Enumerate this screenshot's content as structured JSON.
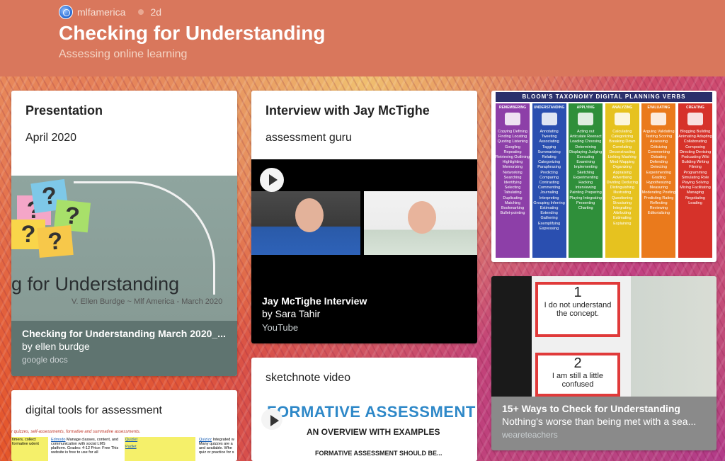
{
  "header": {
    "author": "mlfamerica",
    "age": "2d",
    "title": "Checking for Understanding",
    "subtitle": "Assessing online learning"
  },
  "cards": {
    "presentation": {
      "title": "Presentation",
      "subtitle": "April 2020",
      "slide_text": "g for Understanding",
      "slide_credit": "V. Ellen Burdge ~ Mlf America - March 2020",
      "attachment_title": "Checking for Understanding March 2020_...",
      "attachment_by": "by ellen burdge",
      "attachment_source": "google docs",
      "attachment_bg": "#5f7470"
    },
    "interview": {
      "title": "Interview with Jay McTighe",
      "subtitle": "assessment guru",
      "attachment_title": "Jay McTighe Interview",
      "attachment_by": "by Sara Tahir",
      "attachment_source": "YouTube"
    },
    "bloom": {
      "heading": "BLOOM'S TAXONOMY DIGITAL PLANNING VERBS",
      "columns": [
        {
          "name": "REMEMBERING",
          "color": "#8d3fa8",
          "verbs": "Copying Defining Finding Locating Quoting Listening Googling Repeating Retrieving Outlining Highlighting Memorizing Networking Searching Identifying Selecting Tabulating Duplicating Matching Bookmarking Bullet-pointing"
        },
        {
          "name": "UNDERSTANDING",
          "color": "#2a4fb0",
          "verbs": "Annotating Tweeting Associating Tagging Summarizing Relating Categorizing Paraphrasing Predicting Comparing Contrasting Commenting Journaling Interpreting Grouping Inferring Estimating Extending Gathering Exemplifying Expressing"
        },
        {
          "name": "APPLYING",
          "color": "#2f8f3a",
          "verbs": "Acting out Articulate Reenact Loading Choosing Determining Displaying Judging Executing Examining Implementing Sketching Experimenting Hacking Interviewing Painting Preparing Playing Integrating Presenting Charting"
        },
        {
          "name": "ANALYZING",
          "color": "#e6c21f",
          "verbs": "Calculating Categorizing Breaking Down Correlating Deconstructing Linking Mashing Mind-Mapping Organizing Appraising Advertising Dividing Deducing Distinguishing Illustrating Questioning Structuring Integrating Attributing Estimating Explaining"
        },
        {
          "name": "EVALUATING",
          "color": "#ea7a1c",
          "verbs": "Arguing Validating Testing Scoring Assessing Criticizing Commenting Debating Defending Detecting Experimenting Grading Hypothesizing Measuring Moderating Posting Predicting Rating Reflecting Reviewing Editorializing"
        },
        {
          "name": "CREATING",
          "color": "#d6322a",
          "verbs": "Blogging Building Animating Adapting Collaborating Composing Directing Devising Podcasting Wiki Building Writing Filming Programming Simulating Role Playing Solving Mixing Facilitating Managing Negotiating Leading"
        }
      ]
    },
    "teachers": {
      "card1_num": "1",
      "card1_text": "I do not understand the concept.",
      "card2_num": "2",
      "card2_text": "I am still a little confused",
      "attachment_title": "15+ Ways to Check for Understanding",
      "attachment_by": "Nothing's worse than being met with a sea...",
      "attachment_source": "weareteachers"
    },
    "tools": {
      "title": "digital tools for assessment",
      "header_text": "r quizzes, self-assessments, formative and summative assessments.",
      "cell1": "timers, collect formative udent",
      "cell2_link": "Edmodo",
      "cell2": "Manage classes, content, and communication with social LMS platform. Grades: 4-12 Price: Free This website is free to use for all",
      "cell3_link1": "Quizlet",
      "cell3_link2": "Padlet",
      "cell4_link": "Quizizz",
      "cell4": "Integrated w Many quizzes are a and available. Whe quiz or practice for s"
    },
    "sketch": {
      "title": "sketchnote video",
      "img_title": "FORMATIVE ASSESSMENT",
      "img_sub": "AN OVERVIEW WITH EXAMPLES",
      "img_sub2": "FORMATIVE ASSESSMENT SHOULD BE..."
    }
  }
}
